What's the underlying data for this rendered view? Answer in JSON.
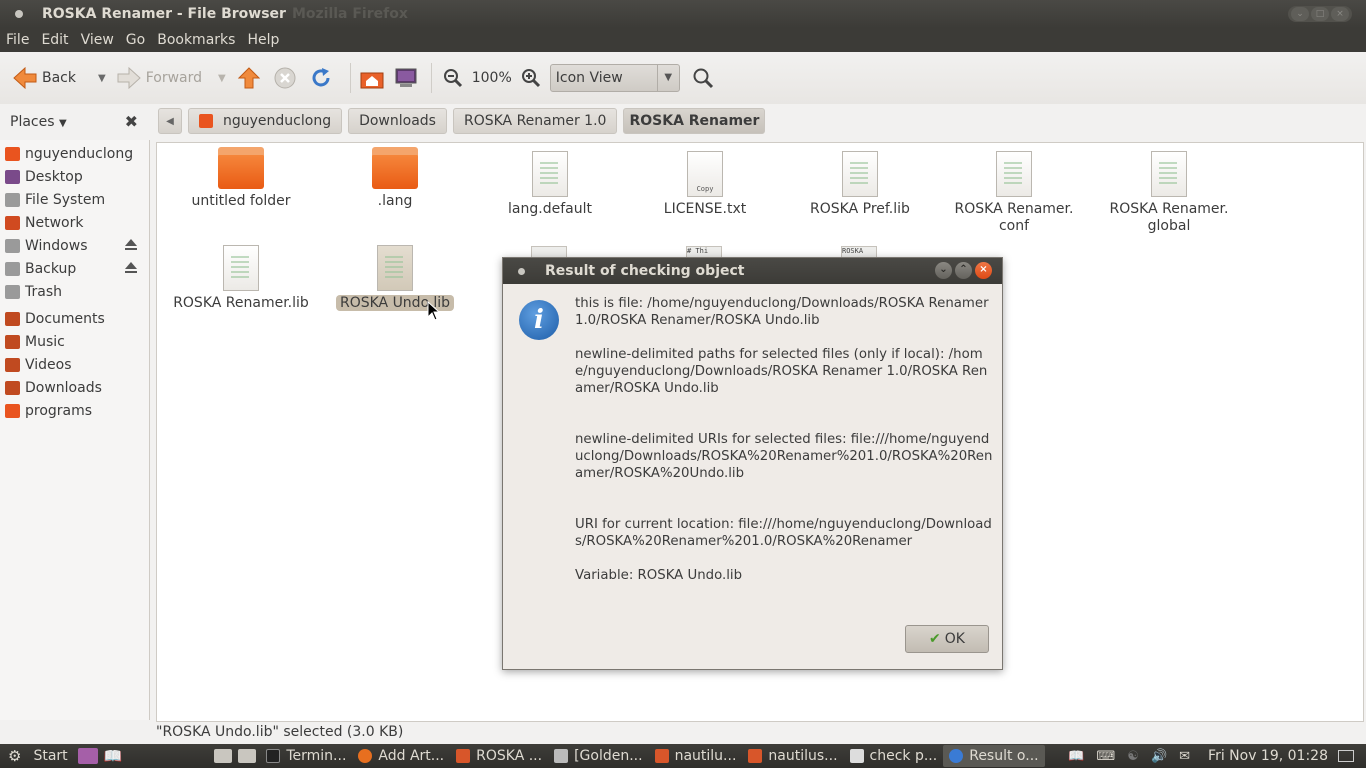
{
  "window": {
    "title": "ROSKA Renamer - File Browser",
    "app": "Mozilla Firefox"
  },
  "menu": [
    "File",
    "Edit",
    "View",
    "Go",
    "Bookmarks",
    "Help"
  ],
  "toolbar": {
    "back": "Back",
    "forward": "Forward",
    "zoom": "100%",
    "view_mode": "Icon View"
  },
  "sidebar": {
    "header": "Places",
    "items": [
      {
        "label": "nguyenduclong",
        "icon": "home-folder-icon",
        "color": "#e9541f"
      },
      {
        "label": "Desktop",
        "icon": "desktop-icon",
        "color": "#7a4a8a"
      },
      {
        "label": "File System",
        "icon": "drive-icon",
        "color": "#8a8a8a"
      },
      {
        "label": "Network",
        "icon": "network-icon",
        "color": "#d04a20"
      },
      {
        "label": "Windows",
        "icon": "drive-icon",
        "color": "#8a8a8a"
      },
      {
        "label": "Backup",
        "icon": "drive-icon",
        "color": "#8a8a8a"
      },
      {
        "label": "Trash",
        "icon": "trash-icon",
        "color": "#8a8a8a"
      },
      {
        "label": "Documents",
        "icon": "documents-folder-icon",
        "color": "#c04a20"
      },
      {
        "label": "Music",
        "icon": "music-folder-icon",
        "color": "#c04a20"
      },
      {
        "label": "Videos",
        "icon": "videos-folder-icon",
        "color": "#c04a20"
      },
      {
        "label": "Downloads",
        "icon": "downloads-folder-icon",
        "color": "#c04a20"
      },
      {
        "label": "programs",
        "icon": "folder-icon",
        "color": "#e9541f"
      }
    ]
  },
  "breadcrumb": [
    "nguyenduclong",
    "Downloads",
    "ROSKA Renamer 1.0",
    "ROSKA Renamer"
  ],
  "files": [
    {
      "name": "untitled folder",
      "type": "folder"
    },
    {
      "name": ".lang",
      "type": "folder"
    },
    {
      "name": "lang.default",
      "type": "text"
    },
    {
      "name": "LICENSE.txt",
      "type": "copying",
      "thumb": "Copy"
    },
    {
      "name": "ROSKA Pref.lib",
      "type": "text"
    },
    {
      "name": "ROSKA Renamer.\nconf",
      "type": "text"
    },
    {
      "name": "ROSKA Renamer.\nglobal",
      "type": "text"
    },
    {
      "name": "ROSKA Renamer.lib",
      "type": "text"
    },
    {
      "name": "ROSKA Undo.lib",
      "type": "text",
      "selected": true
    }
  ],
  "partial_thumbs": [
    "",
    "# Thi",
    "ROSKA"
  ],
  "dialog": {
    "title": "Result of checking object",
    "paragraphs": [
      "this is file: /home/nguyenduclong/Downloads/ROSKA Renamer 1.0/ROSKA Renamer/ROSKA Undo.lib",
      "newline-delimited paths for selected files (only if local): /home/nguyenduclong/Downloads/ROSKA Renamer 1.0/ROSKA Renamer/ROSKA Undo.lib",
      "newline-delimited URIs for selected files: file:///home/nguyenduclong/Downloads/ROSKA%20Renamer%201.0/ROSKA%20Renamer/ROSKA%20Undo.lib",
      "URI for current location: file:///home/nguyenduclong/Downloads/ROSKA%20Renamer%201.0/ROSKA%20Renamer",
      "Variable: ROSKA Undo.lib"
    ],
    "ok": "OK"
  },
  "status": "\"ROSKA Undo.lib\" selected (3.0 KB)",
  "taskbar": {
    "start": "Start",
    "tasks": [
      {
        "label": "Termin...",
        "icon": "terminal-icon",
        "color": "#333333"
      },
      {
        "label": "Add  Art...",
        "icon": "firefox-icon",
        "color": "#e76f1f"
      },
      {
        "label": "ROSKA ...",
        "icon": "folder-icon",
        "color": "#d8562a"
      },
      {
        "label": "[Golden...",
        "icon": "book-icon",
        "color": "#cccccc"
      },
      {
        "label": "nautilu...",
        "icon": "folder-icon",
        "color": "#d8562a"
      },
      {
        "label": "nautilus...",
        "icon": "folder-icon",
        "color": "#d8562a"
      },
      {
        "label": "check p...",
        "icon": "editor-icon",
        "color": "#dddddd"
      },
      {
        "label": "Result o...",
        "icon": "info-icon",
        "color": "#3a7bd5",
        "active": true
      }
    ],
    "clock": "Fri Nov 19, 01:28"
  }
}
